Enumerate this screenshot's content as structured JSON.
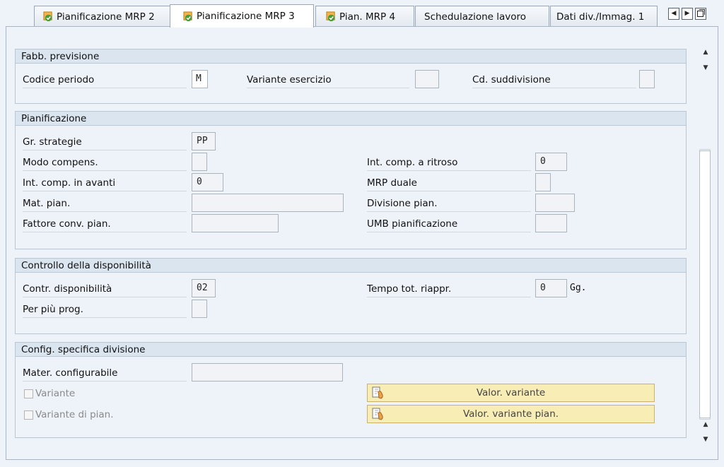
{
  "tabs": [
    {
      "label": "Pianificazione MRP 2",
      "icon": "check-doc-icon"
    },
    {
      "label": "Pianificazione MRP 3",
      "icon": "check-doc-icon",
      "active": true
    },
    {
      "label": "Pian. MRP 4",
      "icon": "check-doc-icon"
    },
    {
      "label": "Schedulazione lavoro"
    },
    {
      "label": "Dati div./Immag. 1"
    }
  ],
  "groups": {
    "forecast": {
      "title": "Fabb. previsione",
      "period_label": "Codice periodo",
      "period_value": "M",
      "fiscal_variant_label": "Variante esercizio",
      "fiscal_variant_value": "",
      "split_label": "Cd. suddivisione",
      "split_value": ""
    },
    "planning": {
      "title": "Pianificazione",
      "strategy_label": "Gr. strategie",
      "strategy_value": "PP",
      "cons_mode_label": "Modo compens.",
      "cons_mode_value": "",
      "bwd_label": "Int. comp. a ritroso",
      "bwd_value": "0",
      "fwd_label": "Int. comp. in avanti",
      "fwd_value": "0",
      "dual_label": "MRP duale",
      "dual_value": "",
      "plan_mat_label": "Mat. pian.",
      "plan_mat_value": "",
      "plan_plant_label": "Divisione pian.",
      "plan_plant_value": "",
      "conv_factor_label": "Fattore conv. pian.",
      "conv_factor_value": "",
      "plan_uom_label": "UMB pianificazione",
      "plan_uom_value": ""
    },
    "availability": {
      "title": "Controllo della disponibilità",
      "check_label": "Contr. disponibilità",
      "check_value": "02",
      "lead_label": "Tempo tot. riappr.",
      "lead_value": "0",
      "lead_unit": "Gg",
      "multi_label": "Per più prog.",
      "multi_value": ""
    },
    "config": {
      "title": "Config. specifica divisione",
      "conf_mat_label": "Mater. configurabile",
      "conf_mat_value": "",
      "variant_label": "Variante",
      "plan_variant_label": "Variante di pian.",
      "val_variant_button": "Valor. variante",
      "val_plan_variant_button": "Valor. variante pian."
    }
  },
  "colors": {
    "button_bg": "#f9edb6",
    "header_bg": "#dbe5ef",
    "page_bg": "#eef3f9"
  }
}
